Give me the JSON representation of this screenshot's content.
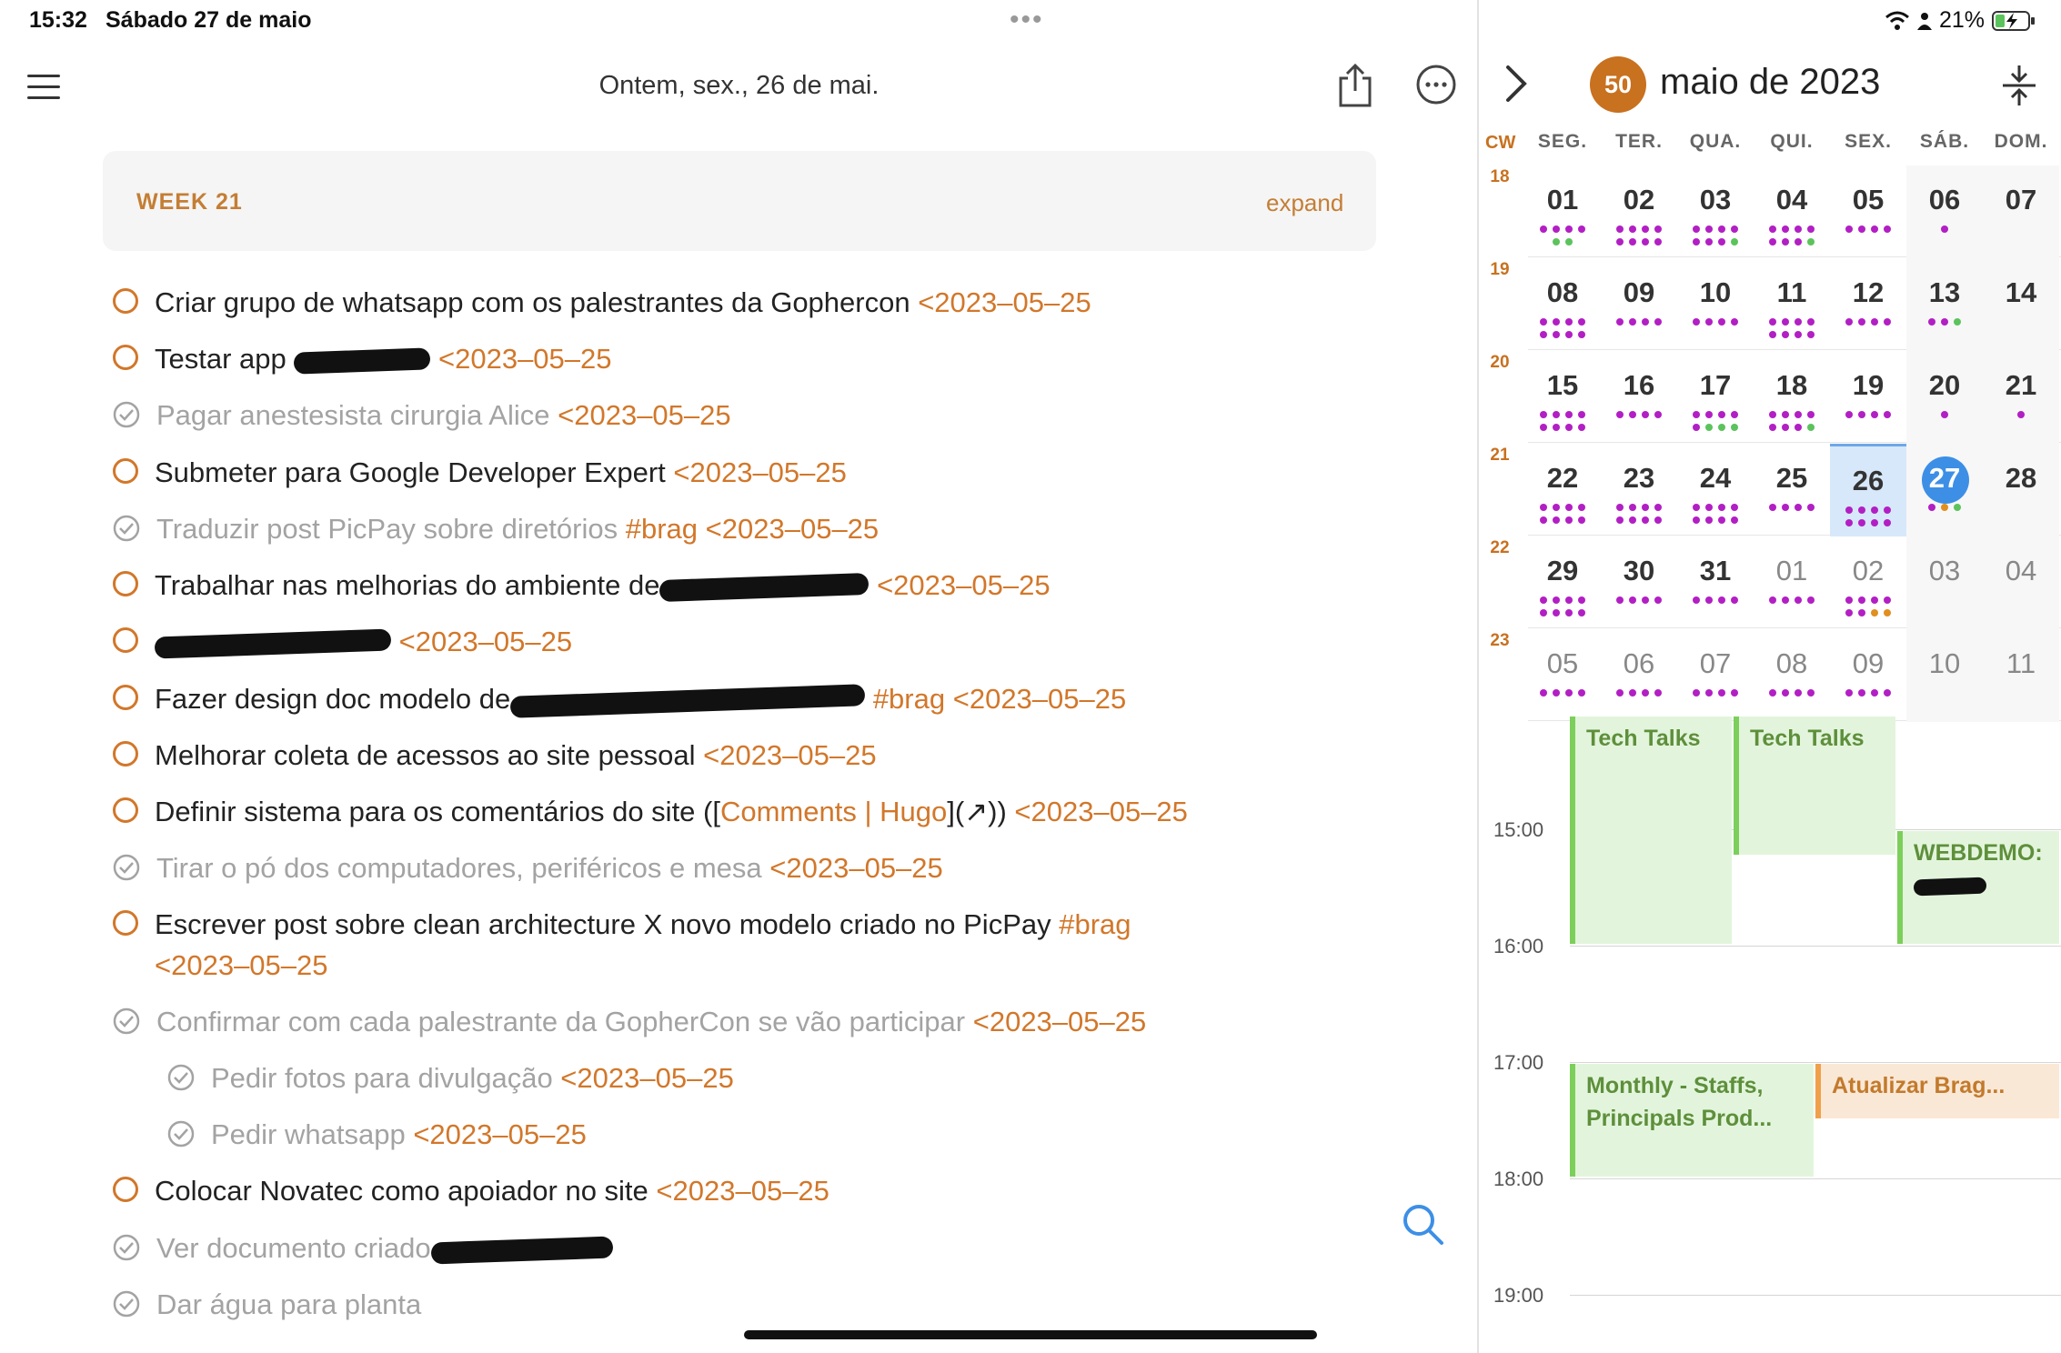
{
  "status": {
    "time": "15:32",
    "date": "Sábado 27 de maio",
    "battery": "21%"
  },
  "header": {
    "date_label": "Ontem, sex., 26 de mai."
  },
  "week": {
    "title": "WEEK 21",
    "expand_label": "expand"
  },
  "tasks": [
    {
      "done": false,
      "text": "Criar grupo de whatsapp com os palestrantes da Gophercon ",
      "date": "<2023–05–25"
    },
    {
      "done": false,
      "text": "Testar app ",
      "date": "<2023–05–25"
    },
    {
      "done": true,
      "text": "Pagar anestesista cirurgia Alice ",
      "date": "<2023–05–25"
    },
    {
      "done": false,
      "text": "Submeter para Google Developer Expert ",
      "date": "<2023–05–25"
    },
    {
      "done": true,
      "text": "Traduzir post PicPay sobre diretórios ",
      "tag": "#brag",
      "date": "<2023–05–25"
    },
    {
      "done": false,
      "text": "Trabalhar nas melhorias do ambiente de",
      "date": "<2023–05–25"
    },
    {
      "done": false,
      "text": "",
      "date": "<2023–05–25"
    },
    {
      "done": false,
      "text": "Fazer design doc modelo de",
      "tag": "#brag",
      "date": "<2023–05–25"
    },
    {
      "done": false,
      "text": "Melhorar coleta de acessos ao site pessoal ",
      "date": "<2023–05–25"
    },
    {
      "done": false,
      "text": "Definir sistema para os comentários do site ([",
      "link": "Comments | Hugo",
      "text_after": "](↗)) ",
      "date": "<2023–05–25"
    },
    {
      "done": true,
      "text": "Tirar o pó dos computadores, periféricos e mesa ",
      "date": "<2023–05–25"
    },
    {
      "done": false,
      "text": "Escrever post sobre clean architecture X novo modelo criado no PicPay ",
      "tag": "#brag",
      "date": "<2023–05–25"
    },
    {
      "done": true,
      "text": "Confirmar com cada palestrante da GopherCon se vão participar ",
      "date": "<2023–05–25"
    },
    {
      "done": true,
      "text": "Pedir fotos para divulgação ",
      "date": "<2023–05–25"
    },
    {
      "done": true,
      "text": "Pedir whatsapp ",
      "date": "<2023–05–25"
    },
    {
      "done": false,
      "text": "Colocar Novatec como apoiador no site ",
      "date": "<2023–05–25"
    },
    {
      "done": true,
      "text": "Ver documento criado",
      "date": ""
    },
    {
      "done": true,
      "text": "Dar água para planta",
      "date": ""
    }
  ],
  "calendar": {
    "badge": "50",
    "month_title": "maio de 2023",
    "cw_header": "CW",
    "weekday_headers": [
      "SEG.",
      "TER.",
      "QUA.",
      "QUI.",
      "SEX.",
      "SÁB.",
      "DOM."
    ],
    "weeks": [
      {
        "cw": "18",
        "days": [
          "01",
          "02",
          "03",
          "04",
          "05",
          "06",
          "07"
        ]
      },
      {
        "cw": "19",
        "days": [
          "08",
          "09",
          "10",
          "11",
          "12",
          "13",
          "14"
        ]
      },
      {
        "cw": "20",
        "days": [
          "15",
          "16",
          "17",
          "18",
          "19",
          "20",
          "21"
        ]
      },
      {
        "cw": "21",
        "days": [
          "22",
          "23",
          "24",
          "25",
          "26",
          "27",
          "28"
        ]
      },
      {
        "cw": "22",
        "days": [
          "29",
          "30",
          "31",
          "01",
          "02",
          "03",
          "04"
        ]
      },
      {
        "cw": "23",
        "days": [
          "05",
          "06",
          "07",
          "08",
          "09",
          "10",
          "11"
        ]
      }
    ]
  },
  "agenda": {
    "times": [
      "15:00",
      "16:00",
      "17:00",
      "18:00",
      "19:00"
    ],
    "events": [
      {
        "title": "Tech Talks",
        "color": "green"
      },
      {
        "title": "Tech Talks",
        "color": "green"
      },
      {
        "title": "WEBDEMO:",
        "color": "green"
      },
      {
        "title": "Monthly - Staffs, Principals Prod...",
        "color": "green"
      },
      {
        "title": "Atualizar Brag...",
        "color": "orange"
      }
    ]
  },
  "colors": {
    "accent": "#d2772a",
    "today": "#3d8fe6",
    "dot": "#b21fc4"
  }
}
